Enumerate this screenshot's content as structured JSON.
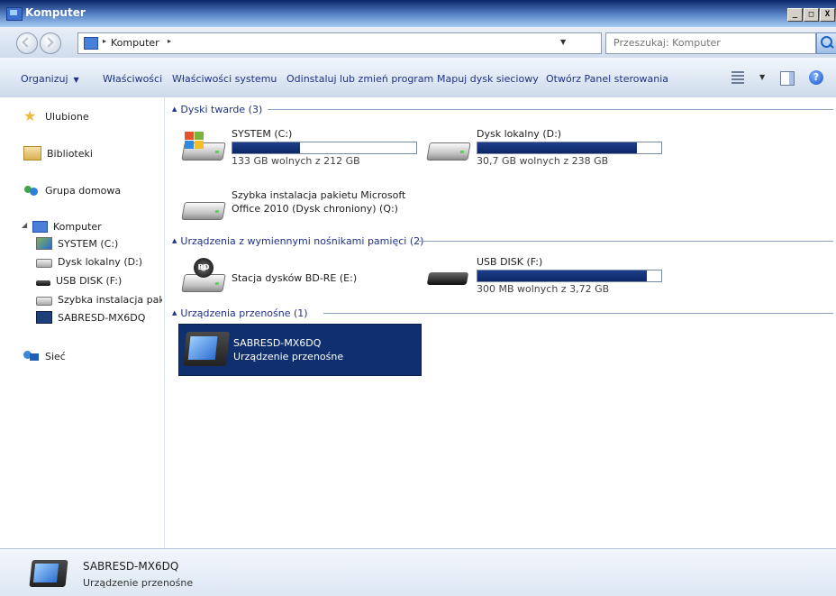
{
  "window": {
    "title": "Komputer",
    "minimize": "_",
    "maximize": "□",
    "close": "X"
  },
  "address": {
    "breadcrumb": "Komputer",
    "search_placeholder": "Przeszukaj: Komputer"
  },
  "toolbar": {
    "organize": "Organizuj",
    "properties": "Właściwości",
    "system_properties": "Właściwości systemu",
    "uninstall": "Odinstaluj lub zmień program",
    "map_drive": "Mapuj dysk sieciowy",
    "control_panel": "Otwórz Panel sterowania"
  },
  "sidebar": {
    "favorites": "Ulubione",
    "libraries": "Biblioteki",
    "homegroup": "Grupa domowa",
    "computer": "Komputer",
    "sub": [
      {
        "label": "SYSTEM (C:)",
        "icon": "windows-drive-icon"
      },
      {
        "label": "Dysk lokalny (D:)",
        "icon": "drive-icon"
      },
      {
        "label": "USB DISK (F:)",
        "icon": "usb-drive-icon"
      },
      {
        "label": "Szybka instalacja pakietu",
        "icon": "drive-icon"
      },
      {
        "label": "SABRESD-MX6DQ",
        "icon": "device-icon"
      }
    ],
    "network": "Sieć"
  },
  "groups": {
    "hard_disks": "Dyski twarde (3)",
    "removable": "Urządzenia z wymiennymi nośnikami pamięci (2)",
    "portable": "Urządzenia przenośne (1)"
  },
  "drives": {
    "c": {
      "name": "SYSTEM (C:)",
      "free": "133 GB wolnych z 212 GB",
      "used_fraction": 0.37
    },
    "d": {
      "name": "Dysk lokalny (D:)",
      "free": "30,7 GB wolnych z 238 GB",
      "used_fraction": 0.87
    },
    "q": {
      "name_line1": "Szybka instalacja pakietu Microsoft",
      "name_line2": "Office 2010 (Dysk chroniony) (Q:)"
    },
    "e": {
      "name": "Stacja dysków BD-RE (E:)",
      "disc_label": "BD"
    },
    "f": {
      "name": "USB DISK (F:)",
      "free": "300 MB wolnych z 3,72 GB",
      "used_fraction": 0.92
    }
  },
  "device": {
    "name": "SABRESD-MX6DQ",
    "type": "Urządzenie przenośne"
  },
  "details": {
    "name": "SABRESD-MX6DQ",
    "type": "Urządzenie przenośne"
  },
  "colors": {
    "selection": "#0f2f6e",
    "bar_fill": "#1d3e8a",
    "link_blue": "#1e3287"
  }
}
